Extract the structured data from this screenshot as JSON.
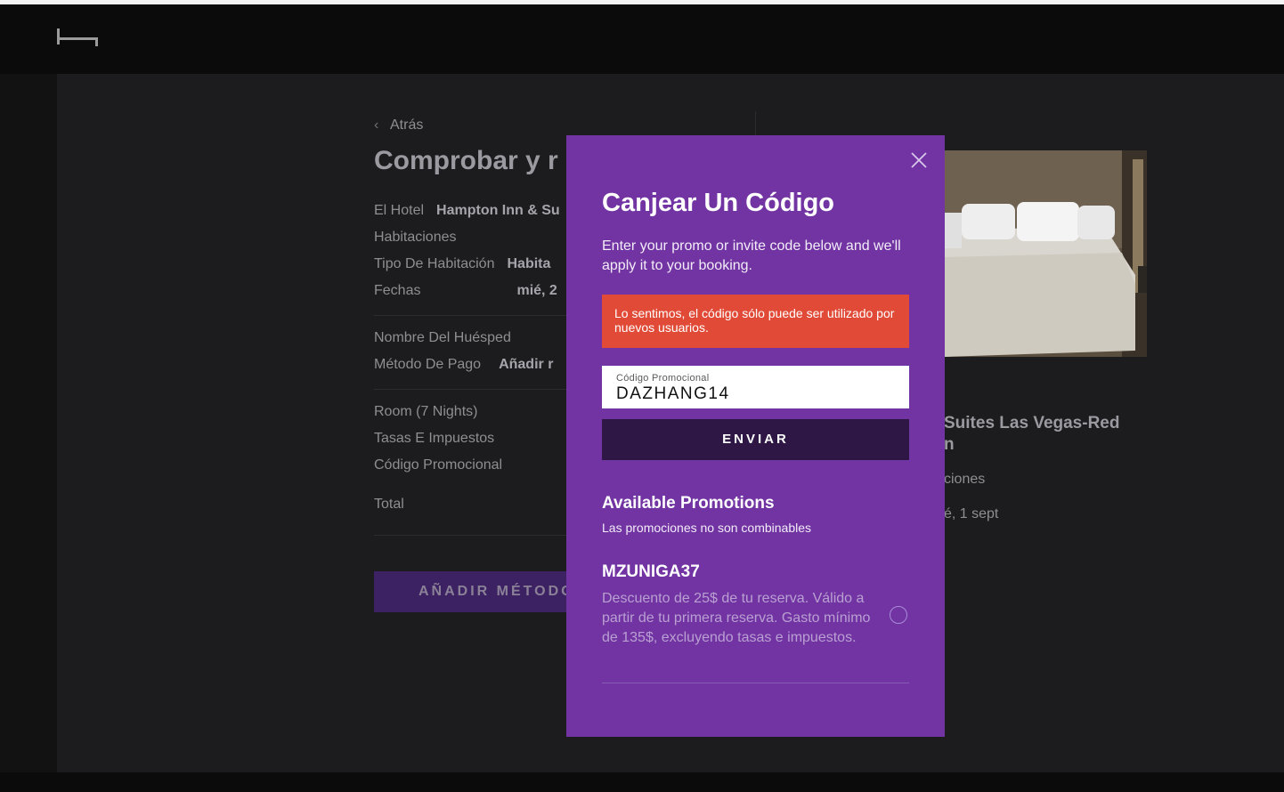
{
  "left": {
    "back_label": "Atrás",
    "title": "Comprobar y r",
    "summary": [
      {
        "label": "El Hotel",
        "value": "Hampton Inn & Su"
      },
      {
        "label": "Habitaciones",
        "value": ""
      },
      {
        "label": "Tipo De Habitación",
        "value": "Habita"
      },
      {
        "label": "Fechas",
        "value": "mié, 2"
      }
    ],
    "guest": [
      {
        "label": "Nombre Del Huésped",
        "value": ""
      },
      {
        "label": "Método De Pago",
        "value": "Añadir r"
      }
    ],
    "price": [
      {
        "label": "Room (7 Nights)"
      },
      {
        "label": "Tasas E Impuestos"
      },
      {
        "label": "Código Promocional"
      }
    ],
    "total_label": "Total",
    "cta_label": "AÑADIR MÉTODO"
  },
  "right": {
    "hotel_name_line1": "Suites Las Vegas-Red",
    "hotel_name_line2": "n",
    "rooms_text": "ciones",
    "dates_text": "é, 1 sept"
  },
  "modal": {
    "title": "Canjear Un Código",
    "description": "Enter your promo or invite code below and we'll apply it to your booking.",
    "error": "Lo sentimos, el código sólo puede ser utilizado por nuevos usuarios.",
    "field_label": "Código Promocional",
    "field_value": "DAZHANG14",
    "submit_label": "ENVIAR",
    "available_title": "Available Promotions",
    "available_subtitle": "Las promociones no son combinables",
    "promos": [
      {
        "code": "MZUNIGA37",
        "description": "Descuento de 25$ de tu reserva. Válido a partir de tu primera reserva. Gasto mínimo de 135$, excluyendo tasas e impuestos.",
        "selected": false
      }
    ]
  },
  "colors": {
    "modal_bg": "#7234a3",
    "error_bg": "#e04a36",
    "submit_bg": "#2e1745",
    "page_bg": "#1c1c1e"
  }
}
